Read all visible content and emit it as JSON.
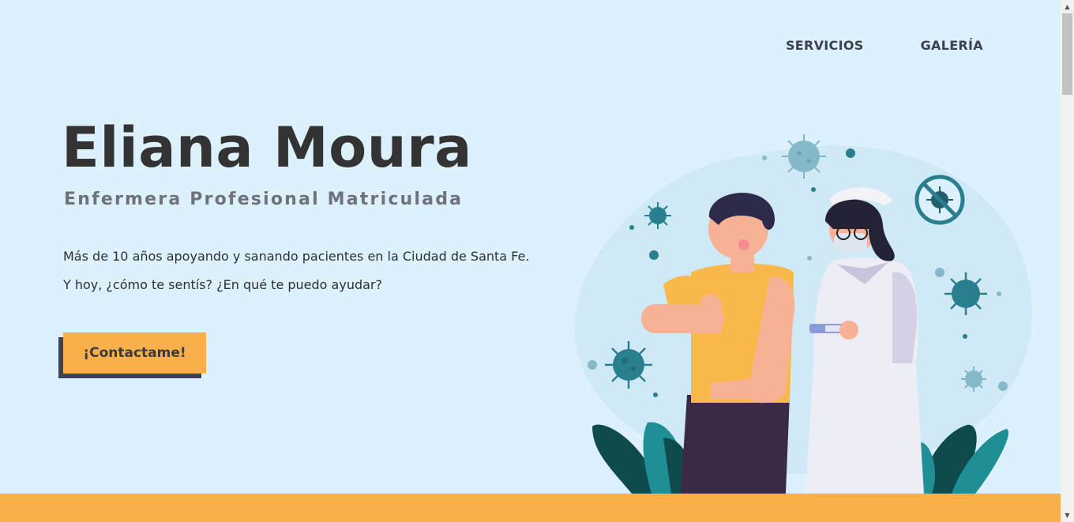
{
  "nav": {
    "items": [
      {
        "label": "SERVICIOS"
      },
      {
        "label": "GALERÍA"
      }
    ]
  },
  "hero": {
    "title": "Eliana Moura",
    "subtitle": "Enfermera Profesional Matriculada",
    "line1": "Más de 10 años apoyando y sanando pacientes en la Ciudad de Santa Fe.",
    "line2": "Y hoy, ¿cómo te sentís? ¿En qué te puedo ayudar?",
    "cta_label": "¡Contactame!"
  },
  "illustration": {
    "icon": "nurse-vaccination-illustration"
  },
  "colors": {
    "background": "#dcf1fb",
    "accent": "#f9b04a",
    "title": "#333333",
    "subtitle": "#6e727a",
    "button_shadow": "#3b4454",
    "virus": "#2a7f8f"
  }
}
